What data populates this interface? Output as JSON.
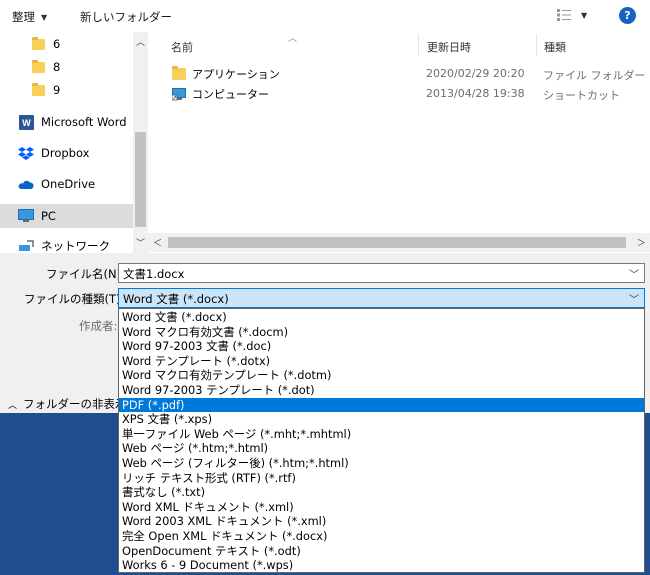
{
  "toolbar": {
    "organize": "整理",
    "new_folder": "新しいフォルダー",
    "help": "?"
  },
  "colors": {
    "accent": "#0078d7",
    "help_blue": "#1565c0",
    "folder": "#f8cf59",
    "footer": "#1f4d8f"
  },
  "nav": {
    "items": [
      {
        "label": "6",
        "icon": "folder-icon"
      },
      {
        "label": "8",
        "icon": "folder-icon"
      },
      {
        "label": "9",
        "icon": "folder-icon"
      },
      {
        "label": "Microsoft Word",
        "icon": "word-icon"
      },
      {
        "label": "Dropbox",
        "icon": "dropbox-icon"
      },
      {
        "label": "OneDrive",
        "icon": "cloud-icon"
      },
      {
        "label": "PC",
        "icon": "pc-icon"
      },
      {
        "label": "ネットワーク",
        "icon": "network-icon"
      }
    ]
  },
  "list": {
    "columns": {
      "name": "名前",
      "date": "更新日時",
      "type": "種類"
    },
    "rows": [
      {
        "name": "アプリケーション",
        "date": "2020/02/29 20:20",
        "type": "ファイル フォルダー",
        "icon": "folder-icon"
      },
      {
        "name": "コンピューター",
        "date": "2013/04/28 19:38",
        "type": "ショートカット",
        "icon": "shortcut-icon"
      }
    ]
  },
  "form": {
    "filename_label": "ファイル名(N):",
    "filename_value": "文書1.docx",
    "filetype_label": "ファイルの種類(T):",
    "filetype_value": "Word 文書 (*.docx)",
    "author_label": "作成者:",
    "hide_folders": "フォルダーの非表示"
  },
  "dropdown": {
    "selected_index": 6,
    "options": [
      "Word 文書 (*.docx)",
      "Word マクロ有効文書 (*.docm)",
      "Word 97-2003 文書 (*.doc)",
      "Word テンプレート (*.dotx)",
      "Word マクロ有効テンプレート (*.dotm)",
      "Word 97-2003 テンプレート (*.dot)",
      "PDF (*.pdf)",
      "XPS 文書 (*.xps)",
      "単一ファイル Web ページ (*.mht;*.mhtml)",
      "Web ページ (*.htm;*.html)",
      "Web ページ (フィルター後) (*.htm;*.html)",
      "リッチ テキスト形式 (RTF) (*.rtf)",
      "書式なし (*.txt)",
      "Word XML ドキュメント (*.xml)",
      "Word 2003 XML ドキュメント (*.xml)",
      "完全 Open XML ドキュメント (*.docx)",
      "OpenDocument テキスト (*.odt)",
      "Works 6 - 9 Document (*.wps)"
    ]
  }
}
